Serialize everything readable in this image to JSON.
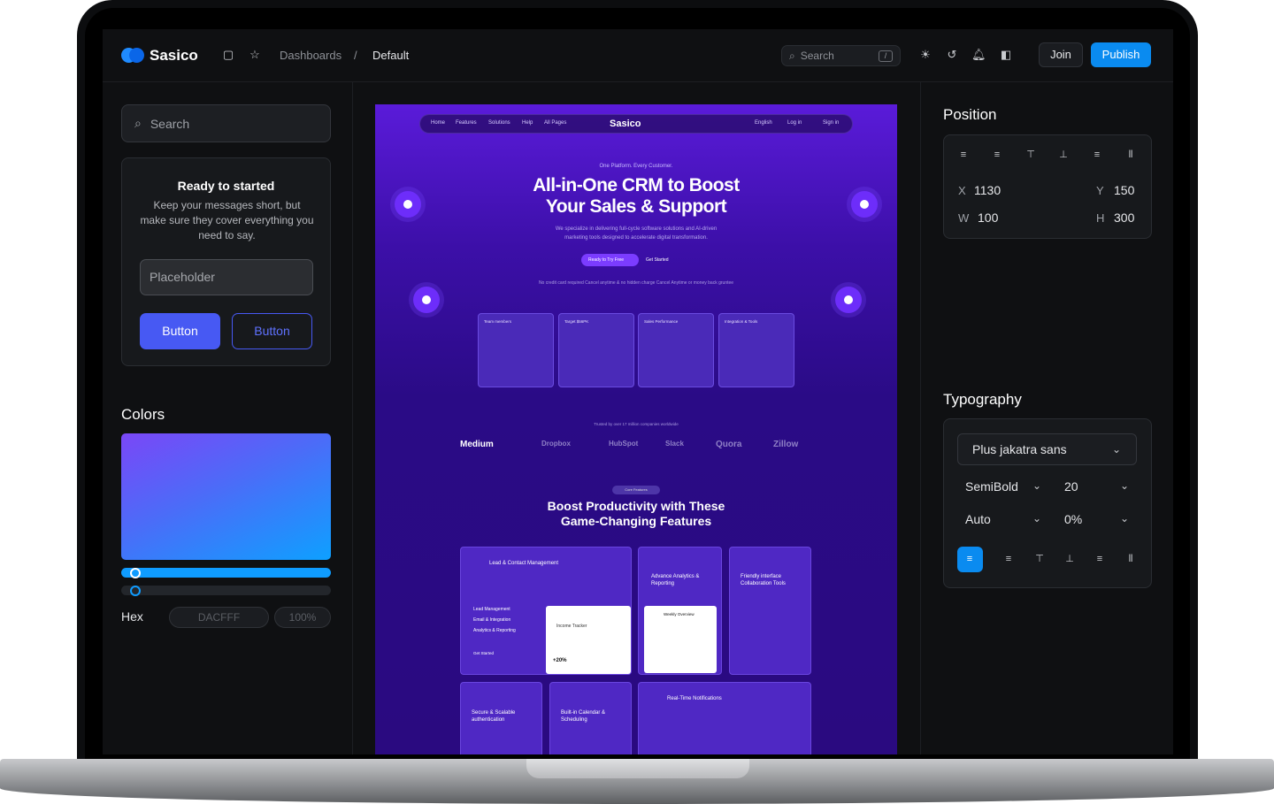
{
  "app": {
    "name": "Sasico"
  },
  "breadcrumbs": [
    "Dashboards",
    "/",
    "Default"
  ],
  "topbar": {
    "search_placeholder": "Search",
    "shortcut": "/",
    "join_label": "Join",
    "publish_label": "Publish"
  },
  "left": {
    "search_placeholder": "Search",
    "card": {
      "title": "Ready to started",
      "text": "Keep your messages short, but make sure they cover everything you need to say.",
      "input_placeholder": "Placeholder",
      "button_primary": "Button",
      "button_secondary": "Button"
    },
    "colors": {
      "title": "Colors",
      "hex_label": "Hex",
      "hex_value": "DACFFF",
      "opacity": "100%",
      "gradient_start": "#7a47f7",
      "gradient_end": "#0ea0ff"
    }
  },
  "canvas": {
    "nav": [
      "Home",
      "Features",
      "Solutions",
      "Help",
      "All Pages",
      "English",
      "Log in",
      "Sign in"
    ],
    "logo": "Sasico",
    "eyebrow": "One Platform. Every Customer.",
    "headline_1": "All-in-One CRM to Boost",
    "headline_2": "Your Sales & Support",
    "description": "We specialize in delivering full-cycle software solutions and AI-driven marketing tools designed to accelerate digital transformation.",
    "cta_primary": "Ready to Try Free",
    "cta_secondary": "Get Started",
    "checks": "No credit card required     Cancel anytime & no hidden charge     Cancel Anytime or money back gruntee",
    "cards": [
      "Team members",
      "Target $56PK",
      "Sales Performance",
      "Integration & Tools"
    ],
    "trusted": "Trusted by over 17 million companies worldwide",
    "brands": [
      "Medium",
      "Dropbox",
      "HubSpot",
      "Slack",
      "Quora",
      "Zillow"
    ],
    "section_pill": "Core Features",
    "section_title_1": "Boost Productivity with These",
    "section_title_2": "Game-Changing Features",
    "features": [
      "Lead & Contact Management",
      "Advance Analytics & Reporting",
      "Friendly interface Collaboration Tools",
      "Secure & Scalable authentication",
      "Built-in Calendar & Scheduling",
      "Real-Time Notifications"
    ],
    "feature_list": [
      "Lead Management",
      "Email & Integration",
      "Analytics & Reporting"
    ],
    "feature_cta": "Get Started",
    "income_tracker": "Income Tracker",
    "weekly_overview": "Weekly Overview",
    "income_pct": "+20%"
  },
  "right": {
    "position": {
      "title": "Position",
      "x_label": "X",
      "x": "1130",
      "y_label": "Y",
      "y": "150",
      "w_label": "W",
      "w": "100",
      "h_label": "H",
      "h": "300"
    },
    "typography": {
      "title": "Typography",
      "font": "Plus jakatra sans",
      "weight": "SemiBold",
      "size": "20",
      "line_height": "Auto",
      "letter_spacing": "0%"
    }
  },
  "colors": {
    "accent": "#0a8bf0",
    "button": "#4759f3",
    "bg": "#0f1012",
    "panel": "#17191c"
  }
}
